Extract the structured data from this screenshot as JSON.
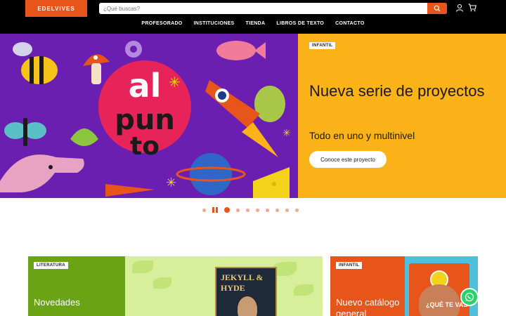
{
  "header": {
    "logo": "EDELVIVES",
    "search_placeholder": "¿Qué buscas?",
    "nav": [
      "PROFESORADO",
      "INSTITUCIONES",
      "TIENDA",
      "LIBROS DE TEXTO",
      "CONTACTO"
    ],
    "icons": [
      "search-icon",
      "user-icon",
      "cart-icon"
    ]
  },
  "hero": {
    "art_text": [
      "al",
      "pun",
      "to"
    ],
    "tag": "INFANTIL",
    "title": "Nueva serie de proyectos",
    "subtitle": "Todo en uno y multinivel",
    "button": "Conoce este proyecto",
    "colors": {
      "panel": "#fcb319",
      "art_bg": "#6b1fb1",
      "accent": "#e8551a"
    }
  },
  "carousel": {
    "slides": 9,
    "active_index": 1
  },
  "cards": [
    {
      "tag": "LITERATURA",
      "title": "Novedades",
      "book_title": "JEKYLL & HYDE"
    },
    {
      "tag": "INFANTIL",
      "title": "Nuevo catálogo general",
      "cover_text": "¿QUÉ TE VAS"
    }
  ]
}
